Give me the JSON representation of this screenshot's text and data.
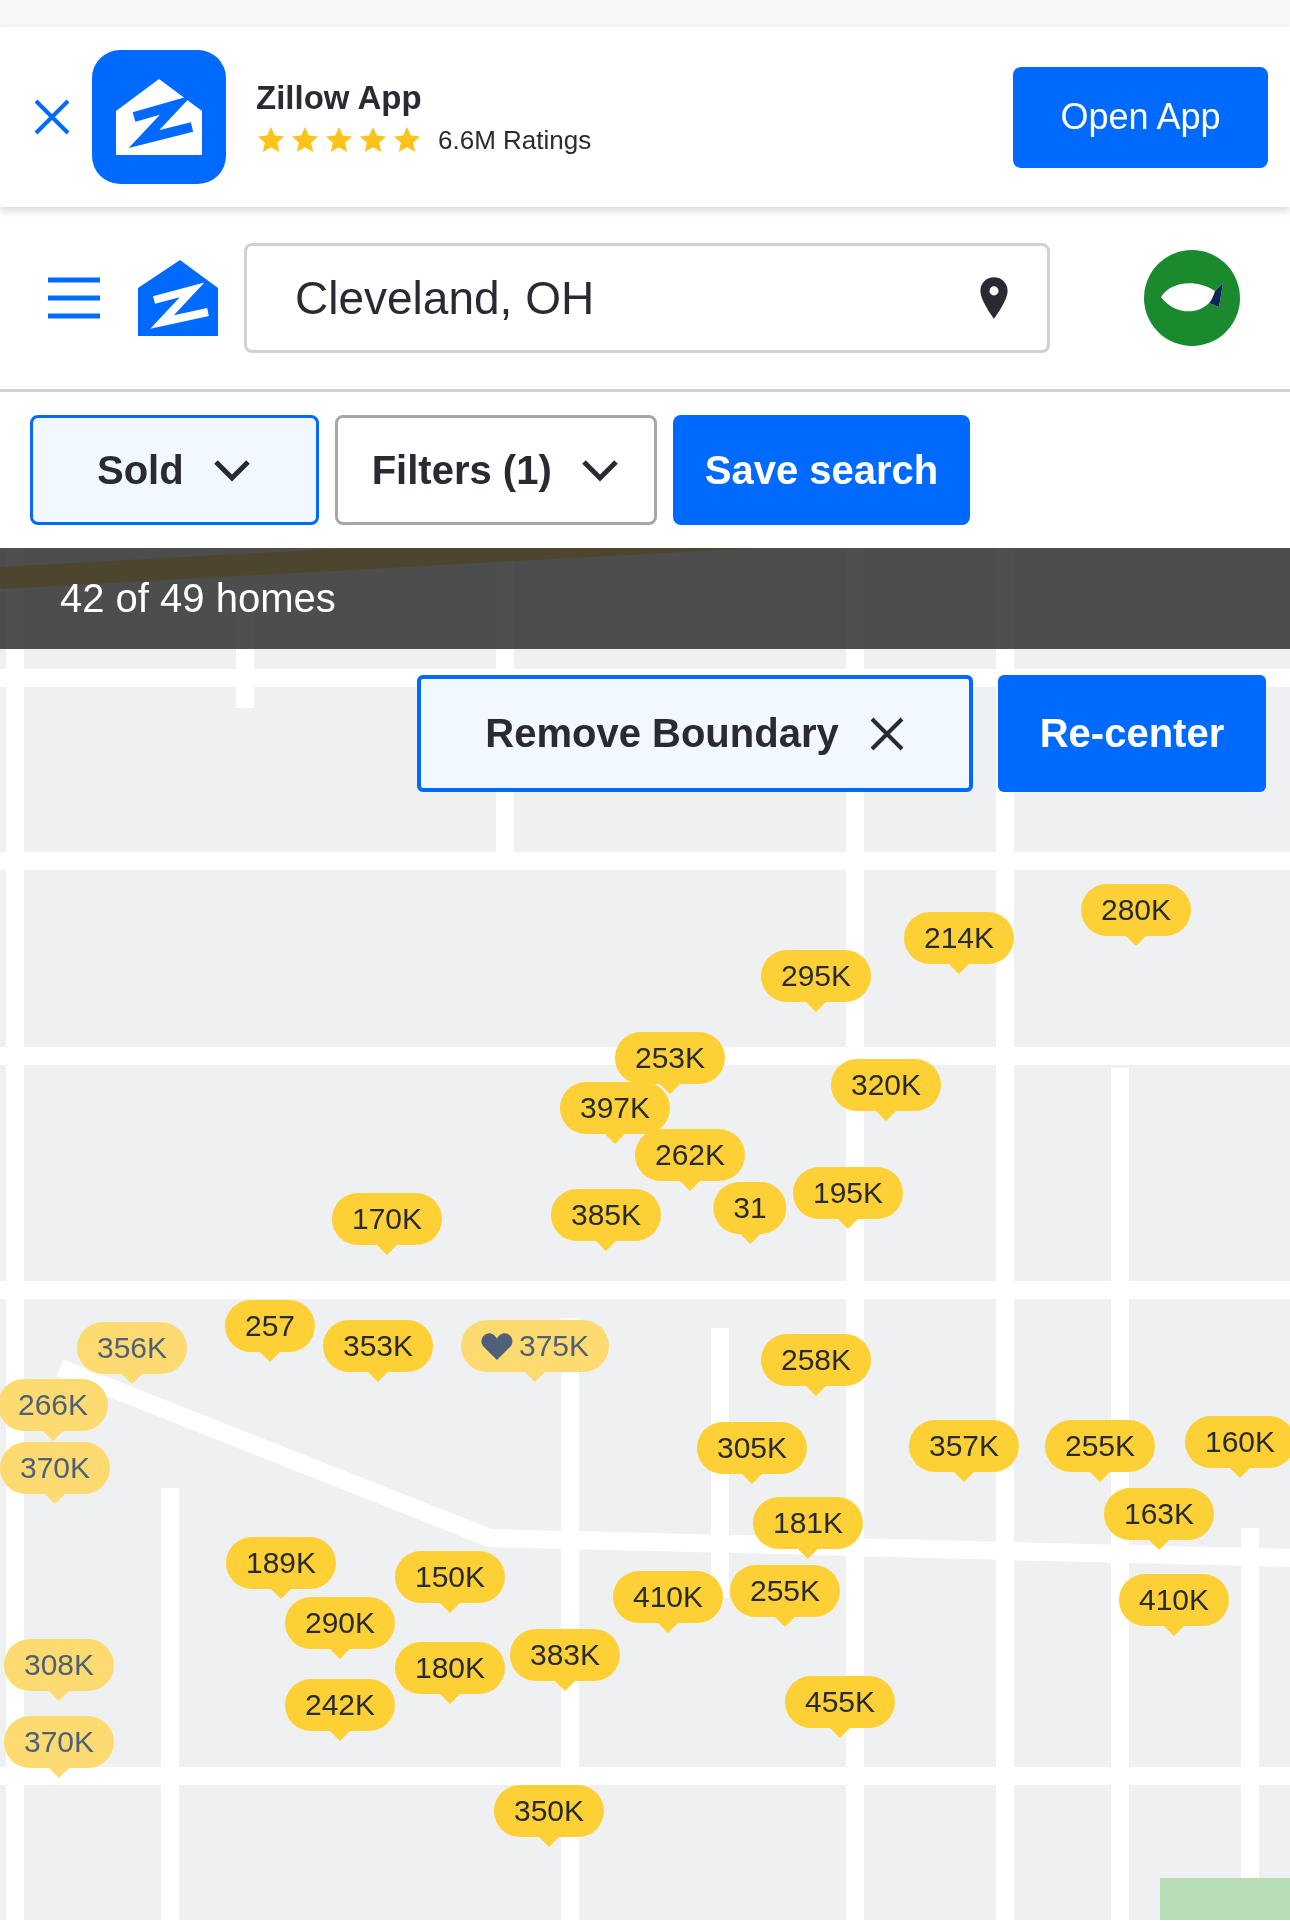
{
  "app_banner": {
    "title": "Zillow App",
    "stars": 5,
    "ratings": "6.6M Ratings",
    "button": "Open App"
  },
  "header": {
    "search": {
      "value": "Cleveland, OH"
    }
  },
  "filters": [
    {
      "label": "Sold",
      "selected": true
    },
    {
      "label": "Filters (1)",
      "selected": false
    }
  ],
  "save_button": "Save search",
  "map": {
    "result_count": "42 of 49 homes",
    "remove_boundary": "Remove Boundary",
    "recenter": "Re-center",
    "pins": [
      {
        "price": "280K",
        "visited": false,
        "saved": false
      },
      {
        "price": "214K",
        "visited": false,
        "saved": false
      },
      {
        "price": "295K",
        "visited": false,
        "saved": false
      },
      {
        "price": "253K",
        "visited": false,
        "saved": false
      },
      {
        "price": "320K",
        "visited": false,
        "saved": false
      },
      {
        "price": "397K",
        "visited": false,
        "saved": false
      },
      {
        "price": "262K",
        "visited": false,
        "saved": false
      },
      {
        "price": "385K",
        "visited": false,
        "saved": false
      },
      {
        "price": "31",
        "visited": false,
        "saved": false
      },
      {
        "price": "195K",
        "visited": false,
        "saved": false
      },
      {
        "price": "170K",
        "visited": false,
        "saved": false
      },
      {
        "price": "356K",
        "visited": true,
        "saved": false
      },
      {
        "price": "257",
        "visited": false,
        "saved": false
      },
      {
        "price": "353K",
        "visited": false,
        "saved": false
      },
      {
        "price": "375K",
        "visited": true,
        "saved": true
      },
      {
        "price": "266K",
        "visited": true,
        "saved": false
      },
      {
        "price": "370K",
        "visited": true,
        "saved": false
      },
      {
        "price": "258K",
        "visited": false,
        "saved": false
      },
      {
        "price": "305K",
        "visited": false,
        "saved": false
      },
      {
        "price": "357K",
        "visited": false,
        "saved": false
      },
      {
        "price": "255K",
        "visited": false,
        "saved": false
      },
      {
        "price": "160K",
        "visited": false,
        "saved": false
      },
      {
        "price": "181K",
        "visited": false,
        "saved": false
      },
      {
        "price": "163K",
        "visited": false,
        "saved": false
      },
      {
        "price": "189K",
        "visited": false,
        "saved": false
      },
      {
        "price": "150K",
        "visited": false,
        "saved": false
      },
      {
        "price": "290K",
        "visited": false,
        "saved": false
      },
      {
        "price": "410K",
        "visited": false,
        "saved": false
      },
      {
        "price": "255K",
        "visited": false,
        "saved": false
      },
      {
        "price": "410K",
        "visited": false,
        "saved": false
      },
      {
        "price": "308K",
        "visited": true,
        "saved": false
      },
      {
        "price": "180K",
        "visited": false,
        "saved": false
      },
      {
        "price": "383K",
        "visited": false,
        "saved": false
      },
      {
        "price": "242K",
        "visited": false,
        "saved": false
      },
      {
        "price": "455K",
        "visited": false,
        "saved": false
      },
      {
        "price": "370K",
        "visited": true,
        "saved": false
      },
      {
        "price": "350K",
        "visited": false,
        "saved": false
      }
    ]
  }
}
